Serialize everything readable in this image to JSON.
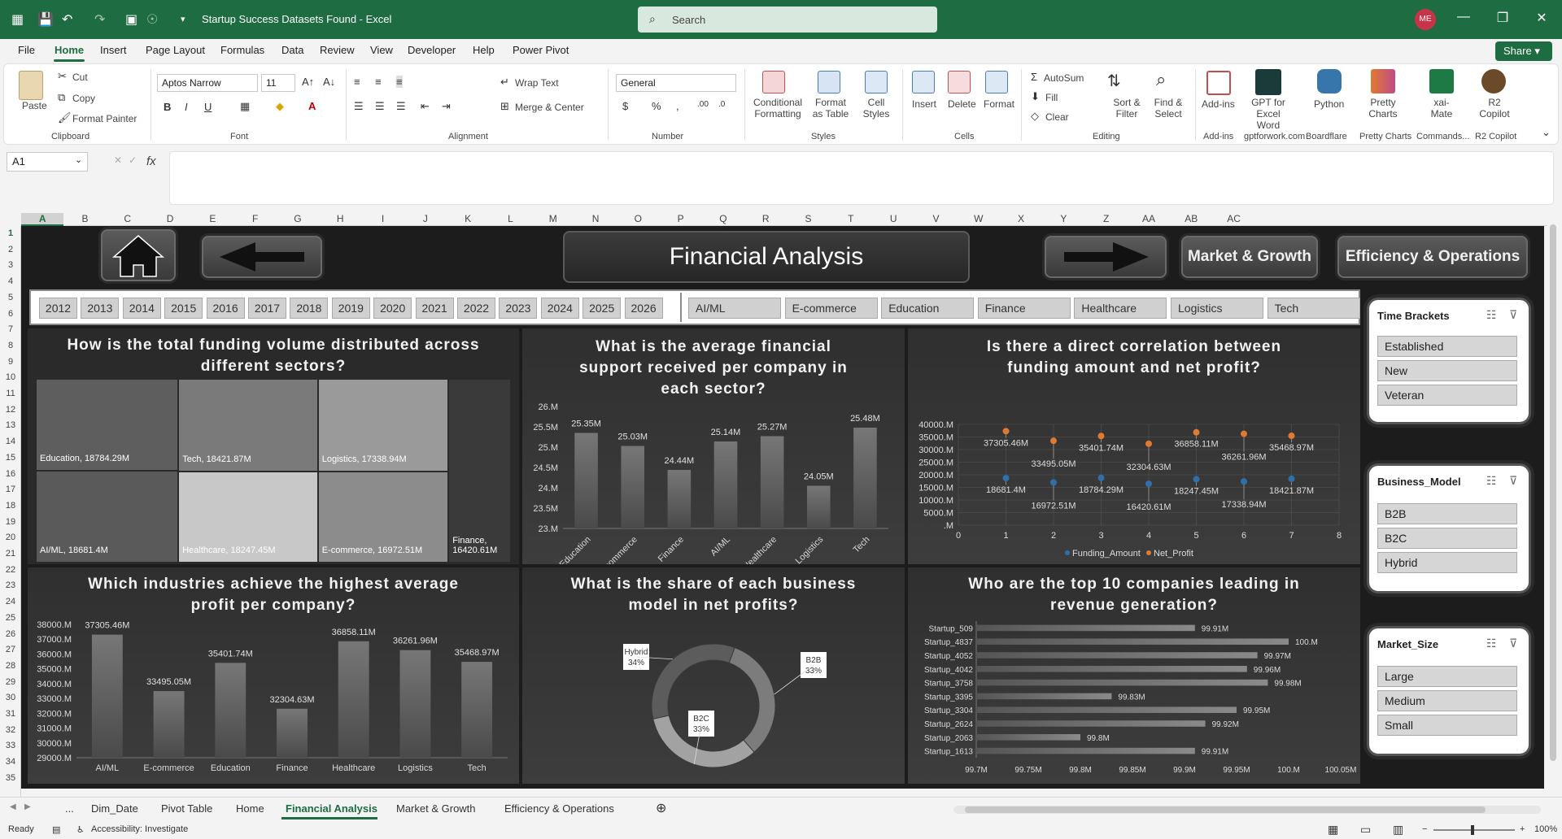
{
  "titlebar": {
    "doc_title": "Startup Success Datasets Found  -  Excel",
    "search_placeholder": "Search",
    "avatar": "ME"
  },
  "menu": [
    "File",
    "Home",
    "Insert",
    "Page Layout",
    "Formulas",
    "Data",
    "Review",
    "View",
    "Developer",
    "Help",
    "Power Pivot"
  ],
  "share_label": "Share",
  "ribbon": {
    "clipboard": {
      "paste": "Paste",
      "cut": "Cut",
      "copy": "Copy",
      "format_painter": "Format Painter",
      "group": "Clipboard"
    },
    "font": {
      "name": "Aptos Narrow",
      "size": "11",
      "group": "Font"
    },
    "alignment": {
      "wrap": "Wrap Text",
      "merge": "Merge & Center",
      "group": "Alignment"
    },
    "number": {
      "format": "General",
      "group": "Number"
    },
    "styles": {
      "cond": "Conditional Formatting",
      "table": "Format as Table",
      "cell": "Cell Styles",
      "group": "Styles"
    },
    "cells": {
      "insert": "Insert",
      "delete": "Delete",
      "format": "Format",
      "group": "Cells"
    },
    "editing": {
      "autosum": "AutoSum",
      "fill": "Fill",
      "clear": "Clear",
      "sort": "Sort & Filter",
      "find": "Find & Select",
      "group": "Editing"
    },
    "addins": [
      {
        "label": "Add-ins",
        "group": "Add-ins",
        "color": "#c0504d"
      },
      {
        "label": "GPT for Excel Word",
        "group": "gptforwork.com",
        "color": "#1b3a3a"
      },
      {
        "label": "Python",
        "group": "Boardflare",
        "color": "#3776ab"
      },
      {
        "label": "Pretty Charts",
        "group": "Pretty Charts",
        "color": "#e07a30"
      },
      {
        "label": "xai-Mate",
        "group": "Commands...",
        "color": "#1e7a45"
      },
      {
        "label": "R2 Copilot",
        "group": "R2 Copilot",
        "color": "#6b4a2a"
      }
    ]
  },
  "namebox": "A1",
  "columns": [
    "A",
    "B",
    "C",
    "D",
    "E",
    "F",
    "G",
    "H",
    "I",
    "J",
    "K",
    "L",
    "M",
    "N",
    "O",
    "P",
    "Q",
    "R",
    "S",
    "T",
    "U",
    "V",
    "W",
    "X",
    "Y",
    "Z",
    "AA",
    "AB",
    "AC"
  ],
  "rows": [
    "1",
    "2",
    "3",
    "4",
    "5",
    "6",
    "7",
    "8",
    "9",
    "10",
    "11",
    "12",
    "13",
    "14",
    "15",
    "16",
    "17",
    "18",
    "19",
    "20",
    "21",
    "22",
    "23",
    "24",
    "25",
    "26",
    "27",
    "28",
    "29",
    "30",
    "31",
    "32",
    "33",
    "34",
    "35"
  ],
  "dashboard": {
    "title": "Financial Analysis",
    "nav_market": "Market & Growth",
    "nav_efficiency": "Efficiency & Operations",
    "years": [
      "2012",
      "2013",
      "2014",
      "2015",
      "2016",
      "2017",
      "2018",
      "2019",
      "2020",
      "2021",
      "2022",
      "2023",
      "2024",
      "2025",
      "2026"
    ],
    "sectors": [
      "AI/ML",
      "E-commerce",
      "Education",
      "Finance",
      "Healthcare",
      "Logistics",
      "Tech"
    ],
    "titles": {
      "treemap": "How is the total funding volume distributed across different sectors?",
      "avg_support": "What is the average financial support received per company in each sector?",
      "correlation": "Is there a direct correlation between funding amount and net profit?",
      "profit": "Which industries achieve the highest average profit per company?",
      "share": "What is the share of each business model in net profits?",
      "top10": "Who are the top 10 companies leading in revenue generation?"
    },
    "slicers": {
      "time": {
        "title": "Time Brackets",
        "items": [
          "Established",
          "New",
          "Veteran"
        ]
      },
      "business": {
        "title": "Business_Model",
        "items": [
          "B2B",
          "B2C",
          "Hybrid"
        ]
      },
      "market": {
        "title": "Market_Size",
        "items": [
          "Large",
          "Medium",
          "Small"
        ]
      }
    }
  },
  "chart_data": [
    {
      "type": "heatmap",
      "title": "How is the total funding volume distributed across different sectors?",
      "categories": [
        "Education",
        "Tech",
        "Logistics",
        "AI/ML",
        "Healthcare",
        "E-commerce",
        "Finance"
      ],
      "values": [
        18784.29,
        18421.87,
        17338.94,
        18681.4,
        18247.45,
        16972.51,
        16420.61
      ],
      "labels": [
        "Education, 18784.29M",
        "Tech, 18421.87M",
        "Logistics, 17338.94M",
        "AI/ML, 18681.4M",
        "Healthcare, 18247.45M",
        "E-commerce, 16972.51M",
        "Finance, 16420.61M"
      ]
    },
    {
      "type": "bar",
      "title": "What is the average financial support received per company in each sector?",
      "categories": [
        "Education",
        "E-commerce",
        "Finance",
        "AI/ML",
        "Healthcare",
        "Logistics",
        "Tech"
      ],
      "values": [
        25.35,
        25.03,
        24.44,
        25.14,
        25.27,
        24.05,
        25.48
      ],
      "value_labels": [
        "25.35M",
        "25.03M",
        "24.44M",
        "25.14M",
        "25.27M",
        "24.05M",
        "25.48M"
      ],
      "yticks": [
        "26.M",
        "25.5M",
        "25.M",
        "24.5M",
        "24.M",
        "23.5M",
        "23.M"
      ],
      "ylim": [
        23,
        26
      ]
    },
    {
      "type": "scatter",
      "title": "Is there a direct correlation between funding amount and net profit?",
      "x": [
        1,
        2,
        3,
        4,
        5,
        6,
        7
      ],
      "series": [
        {
          "name": "Funding_Amount",
          "color": "#2f6faa",
          "values": [
            18681.4,
            16972.51,
            18784.29,
            16420.61,
            18247.45,
            17338.94,
            18421.87
          ],
          "labels": [
            "18681.4M",
            "16972.51M",
            "18784.29M",
            "16420.61M",
            "18247.45M",
            "17338.94M",
            "18421.87M"
          ]
        },
        {
          "name": "Net_Profit",
          "color": "#e07a30",
          "values": [
            37305.46,
            33495.05,
            35401.74,
            32304.63,
            36858.11,
            36261.96,
            35468.97
          ],
          "labels": [
            "37305.46M",
            "33495.05M",
            "35401.74M",
            "32304.63M",
            "36858.11M",
            "36261.96M",
            "35468.97M"
          ]
        }
      ],
      "yticks": [
        "40000.M",
        "35000.M",
        "30000.M",
        "25000.M",
        "20000.M",
        "15000.M",
        "10000.M",
        "5000.M",
        ".M"
      ],
      "xticks": [
        "0",
        "1",
        "2",
        "3",
        "4",
        "5",
        "6",
        "7",
        "8"
      ],
      "ylim": [
        0,
        40000
      ],
      "xlim": [
        0,
        8
      ]
    },
    {
      "type": "bar",
      "title": "Which industries achieve the highest average profit per company?",
      "categories": [
        "AI/ML",
        "E-commerce",
        "Education",
        "Finance",
        "Healthcare",
        "Logistics",
        "Tech"
      ],
      "values": [
        37305.46,
        33495.05,
        35401.74,
        32304.63,
        36858.11,
        36261.96,
        35468.97
      ],
      "value_labels": [
        "37305.46M",
        "33495.05M",
        "35401.74M",
        "32304.63M",
        "36858.11M",
        "36261.96M",
        "35468.97M"
      ],
      "yticks": [
        "38000.M",
        "37000.M",
        "36000.M",
        "35000.M",
        "34000.M",
        "33000.M",
        "32000.M",
        "31000.M",
        "30000.M",
        "29000.M"
      ],
      "ylim": [
        29000,
        38000
      ]
    },
    {
      "type": "pie",
      "title": "What is the share of each business model in net profits?",
      "categories": [
        "B2B",
        "B2C",
        "Hybrid"
      ],
      "values": [
        33,
        33,
        34
      ],
      "labels": [
        "B2B",
        "B2C",
        "Hybrid"
      ],
      "pct_labels": [
        "33%",
        "33%",
        "34%"
      ]
    },
    {
      "type": "bar",
      "orientation": "horizontal",
      "title": "Who are the top 10 companies leading in revenue generation?",
      "categories": [
        "Startup_509",
        "Startup_4837",
        "Startup_4052",
        "Startup_4042",
        "Startup_3758",
        "Startup_3395",
        "Startup_3304",
        "Startup_2624",
        "Startup_2063",
        "Startup_1613"
      ],
      "values": [
        99.91,
        100.0,
        99.97,
        99.96,
        99.98,
        99.83,
        99.95,
        99.92,
        99.8,
        99.91
      ],
      "value_labels": [
        "99.91M",
        "100.M",
        "99.97M",
        "99.96M",
        "99.98M",
        "99.83M",
        "99.95M",
        "99.92M",
        "99.8M",
        "99.91M"
      ],
      "xticks": [
        "99.7M",
        "99.75M",
        "99.8M",
        "99.85M",
        "99.9M",
        "99.95M",
        "100.M",
        "100.05M"
      ],
      "xlim": [
        99.7,
        100.05
      ]
    }
  ],
  "sheet_tabs": [
    "...",
    "Dim_Date",
    "Pivot Table",
    "Home",
    "Financial Analysis",
    "Market & Growth",
    "Efficiency & Operations"
  ],
  "status": {
    "ready": "Ready",
    "accessibility": "Accessibility: Investigate",
    "zoom": "100%"
  }
}
